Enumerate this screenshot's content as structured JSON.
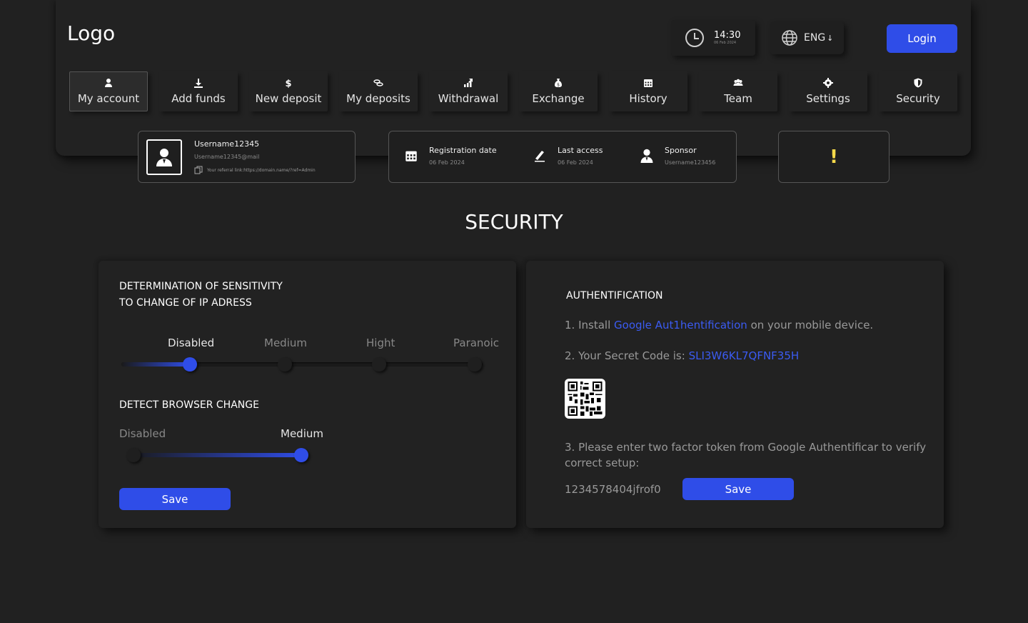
{
  "header": {
    "logo": "Logo",
    "clock": {
      "time": "14:30",
      "date": "06 Feb 2024"
    },
    "language": "ENG",
    "login_label": "Login"
  },
  "nav": [
    {
      "label": "My account",
      "icon": "user-icon",
      "active": true
    },
    {
      "label": "Add funds",
      "icon": "download-icon"
    },
    {
      "label": "New deposit",
      "icon": "dollar-icon"
    },
    {
      "label": "My deposits",
      "icon": "coins-icon"
    },
    {
      "label": "Withdrawal",
      "icon": "chart-up-icon"
    },
    {
      "label": "Exchange",
      "icon": "money-bag-icon"
    },
    {
      "label": "History",
      "icon": "calendar-icon"
    },
    {
      "label": "Team",
      "icon": "team-icon"
    },
    {
      "label": "Settings",
      "icon": "gear-icon"
    },
    {
      "label": "Security",
      "icon": "shield-icon"
    }
  ],
  "user_card": {
    "username": "Username12345",
    "email": "Username12345@mail",
    "referral": "Your referral link:https://domain.name/?ref=Admin"
  },
  "reg_card": {
    "registration": {
      "title": "Registration date",
      "value": "06 Feb 2024"
    },
    "last_access": {
      "title": "Last access",
      "value": "06 Feb 2024"
    },
    "sponsor": {
      "title": "Sponsor",
      "value": "Username123456"
    }
  },
  "alert_mark": "!",
  "page_title": "SECURITY",
  "ip_section": {
    "title_line1": "DETERMINATION OF SENSITIVITY",
    "title_line2": "TO CHANGE OF IP ADRESS",
    "levels": [
      "Disabled",
      "Medium",
      "Hight",
      "Paranoic"
    ],
    "selected_index": 0
  },
  "browser_section": {
    "title": "DETECT BROWSER CHANGE",
    "levels": [
      "Disabled",
      "Medium"
    ],
    "selected_index": 1
  },
  "left_save_label": "Save",
  "auth": {
    "title": "AUTHENTIFICATION",
    "step1_prefix": "1. Install ",
    "step1_link": "Google Aut1hentification",
    "step1_suffix": " on your mobile device.",
    "step2_prefix": "2. Your Secret Code is: ",
    "secret_code": "SLI3W6KL7QFNF35H",
    "step3_line1": "3. Please enter two factor token from Google Authentificar to verify",
    "step3_line2": "correct setup:",
    "token_value": "1234578404jfrof0",
    "save_label": "Save"
  },
  "colors": {
    "accent": "#2f4de8",
    "background": "#212121",
    "alert": "#f5d94a"
  }
}
